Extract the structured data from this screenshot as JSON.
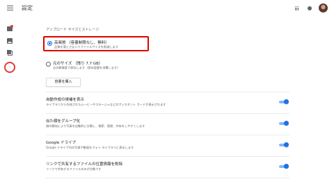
{
  "header": {
    "title": "設定",
    "menu_icon": "hamburger-menu-icon",
    "apps_icon": "apps-grid-icon",
    "notifications_icon": "notifications-icon"
  },
  "nav": {
    "items": [
      {
        "icon": "photos-icon"
      },
      {
        "icon": "albums-icon"
      },
      {
        "icon": "sharing-icon"
      },
      {
        "icon": "more-options-icon",
        "label": "···",
        "highlighted": true
      }
    ]
  },
  "upload": {
    "section_label": "アップロード サイズとストレージ",
    "high_quality": {
      "title": "高画質 （容量制限なし、無料）",
      "desc": "品質を落とさないでファイルサイズを削減します",
      "selected": true
    },
    "original": {
      "title": "元のサイズ （残り 7.7 GB）",
      "desc": "元の解像度で保存します（保存容量を消費します）",
      "selected": false
    },
    "buy_button": "容量を購入"
  },
  "settings": [
    {
      "title": "自動作成の候補を表示",
      "desc": "ライブラリから作成されたムービーやコラージュなどのアシスタント カードが表示されます",
      "enabled": true
    },
    {
      "title": "似た顔をグループ化",
      "desc": "顔の類似により写真を自動的に分類し、検索、管理、共有をしやすくします",
      "enabled": true
    },
    {
      "title": "Google ドライブ",
      "desc": "Google ドライブ内の写真や動画をフォト ライブラリに表示します",
      "enabled": true
    },
    {
      "title": "リンクで共有するファイルの位置情報を削除",
      "desc": "リンクで共有するファイルのみが対象です",
      "enabled": true
    }
  ],
  "colors": {
    "highlight_border": "#e00000",
    "accent": "#1a73e8",
    "notification_dot": "#e53935"
  }
}
